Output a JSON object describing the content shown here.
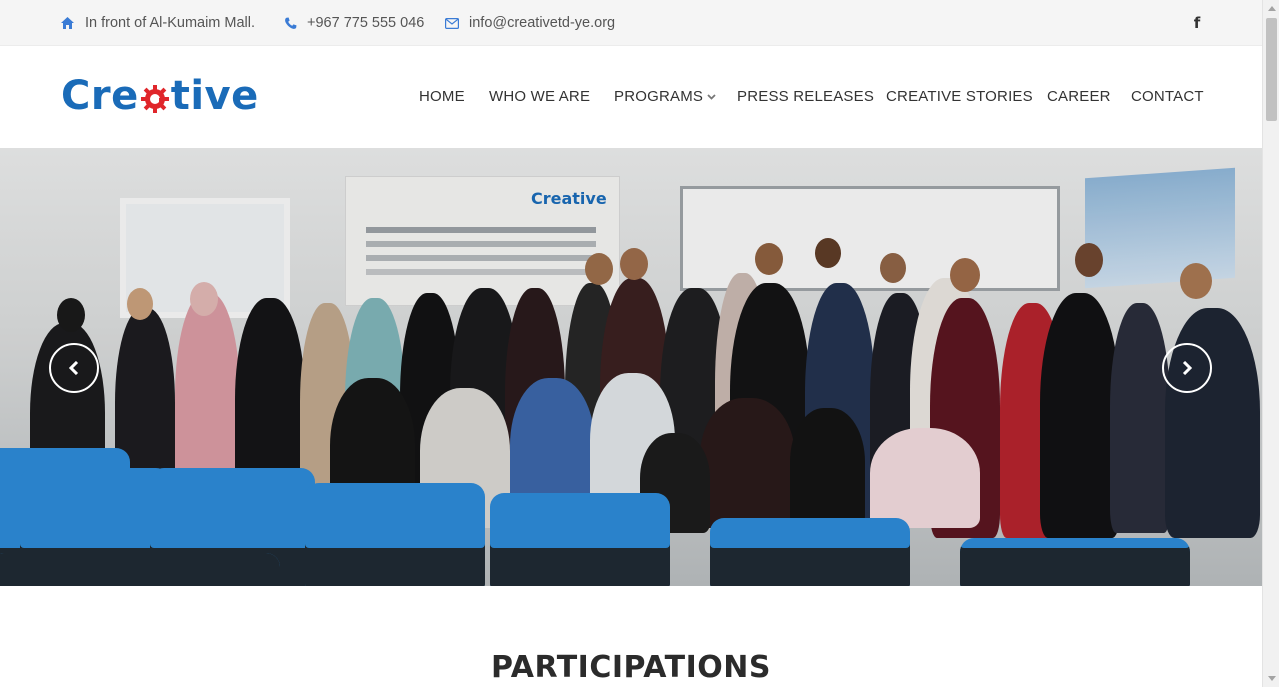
{
  "topbar": {
    "address": "In front of Al-Kumaim Mall.",
    "phone": "+967 775 555 046",
    "email": "info@creativetd-ye.org",
    "social_icon": "facebook-icon"
  },
  "brand": {
    "logo_prefix": "Cre",
    "logo_suffix": "tive",
    "primary_color": "#1a6bb8",
    "accent_color": "#e0262b"
  },
  "nav": {
    "items": [
      {
        "label": "HOME"
      },
      {
        "label": "WHO WE ARE"
      },
      {
        "label": "PROGRAMS",
        "has_dropdown": true
      },
      {
        "label": "PRESS RELEASES"
      },
      {
        "label": "CREATIVE STORIES"
      },
      {
        "label": "CAREER"
      },
      {
        "label": "CONTACT"
      }
    ]
  },
  "hero": {
    "banner_logo": "Creative",
    "prev_icon": "chevron-left-icon",
    "next_icon": "chevron-right-icon"
  },
  "section": {
    "title": "PARTICIPATIONS"
  }
}
